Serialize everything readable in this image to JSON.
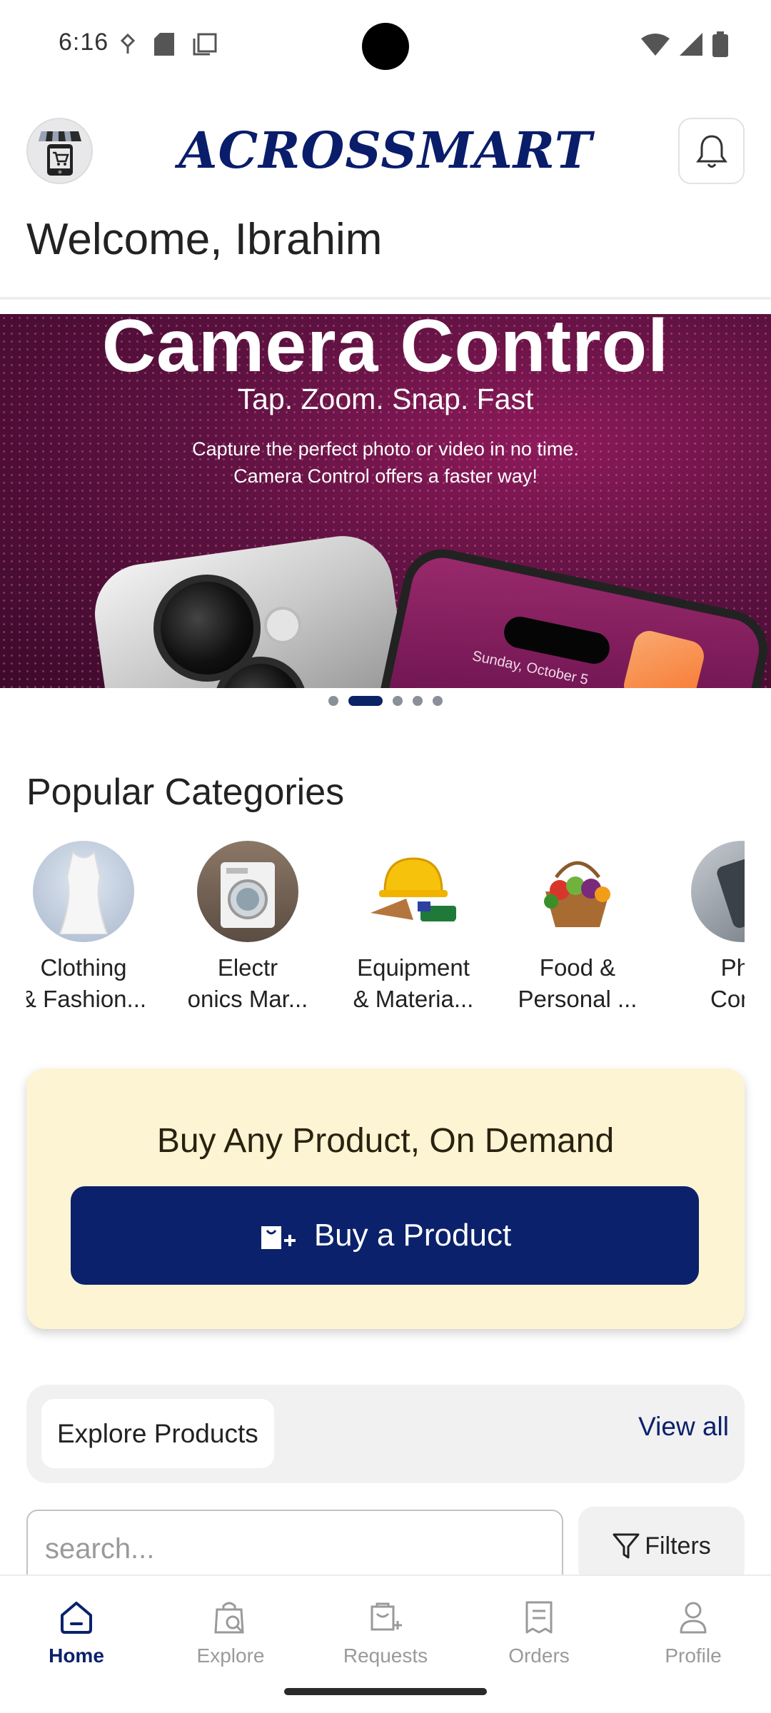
{
  "status_bar": {
    "time": "6:16",
    "left_icons": [
      "data-saver-icon",
      "sd-card-icon",
      "screenshot-icon"
    ],
    "right_icons": [
      "wifi-icon",
      "signal-icon",
      "battery-icon"
    ]
  },
  "header": {
    "brand": "ACROSSMART",
    "welcome": "Welcome, Ibrahim",
    "brand_color": "#0a1d6b",
    "accent_color": "#f3c531"
  },
  "banner": {
    "title": "Camera Control",
    "subtitle": "Tap. Zoom. Snap. Fast",
    "description_line1": "Capture the perfect photo or video in no time.",
    "description_line2": "Camera Control offers a faster way!",
    "phone_date": "Sunday, October 5",
    "slide_count": 5,
    "active_slide": 2
  },
  "categories": {
    "title": "Popular Categories",
    "items": [
      {
        "line1": "Clothing",
        "line2": "& Fashion..."
      },
      {
        "line1": "Electr",
        "line2": "onics Mar..."
      },
      {
        "line1": "Equipment",
        "line2": "& Materia..."
      },
      {
        "line1": "Food &",
        "line2": "Personal ..."
      },
      {
        "line1": "Pho",
        "line2": "Comp"
      }
    ]
  },
  "on_demand": {
    "title": "Buy Any Product, On Demand",
    "button_label": "Buy a Product",
    "card_color": "#fdf4d3",
    "button_color": "#0b216b"
  },
  "explore": {
    "chip_label": "Explore Products",
    "view_all": "View all",
    "search_placeholder": "search...",
    "filters_label": "Filters"
  },
  "bottom_nav": {
    "items": [
      {
        "label": "Home",
        "icon": "home-icon",
        "active": true
      },
      {
        "label": "Explore",
        "icon": "explore-bag-icon",
        "active": false
      },
      {
        "label": "Requests",
        "icon": "requests-icon",
        "active": false
      },
      {
        "label": "Orders",
        "icon": "orders-icon",
        "active": false
      },
      {
        "label": "Profile",
        "icon": "profile-icon",
        "active": false
      }
    ]
  }
}
